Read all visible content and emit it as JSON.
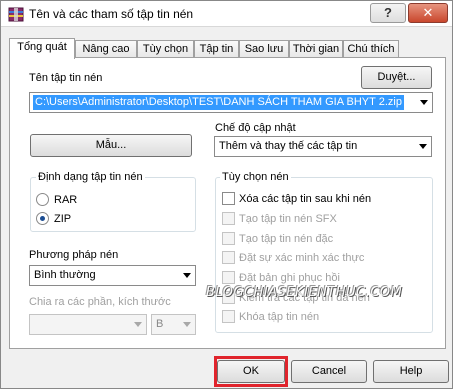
{
  "window": {
    "title": "Tên và các tham số tập tin nén",
    "help_label": "?",
    "close_label": "✕"
  },
  "tabs": [
    {
      "label": "Tổng quát"
    },
    {
      "label": "Nâng cao"
    },
    {
      "label": "Tùy chọn"
    },
    {
      "label": "Tập tin"
    },
    {
      "label": "Sao lưu"
    },
    {
      "label": "Thời gian"
    },
    {
      "label": "Chú thích"
    }
  ],
  "general": {
    "archive_name_label": "Tên tập tin nén",
    "browse_label": "Duyệt...",
    "archive_path": "C:\\Users\\Administrator\\Desktop\\TEST\\DANH SÁCH THAM GIA BHYT 2.zip",
    "update_mode_label": "Chế độ cập nhật",
    "update_mode_value": "Thêm và thay thế các tập tin",
    "profiles_label": "Mẫu...",
    "format_group_label": "Định dạng tập tin nén",
    "format_options": [
      "RAR",
      "ZIP"
    ],
    "format_selected": "ZIP",
    "method_label": "Phương pháp nén",
    "method_value": "Bình thường",
    "split_label": "Chia ra các phần, kích thước",
    "split_value": "",
    "split_unit": "B",
    "options_group_label": "Tùy chọn nén",
    "options": [
      {
        "label": "Xóa các tập tin sau khi nén",
        "enabled": true,
        "checked": false
      },
      {
        "label": "Tạo tập tin nén SFX",
        "enabled": false,
        "checked": false
      },
      {
        "label": "Tạo tập tin nén đặc",
        "enabled": false,
        "checked": false
      },
      {
        "label": "Đặt sự xác minh xác thực",
        "enabled": false,
        "checked": false
      },
      {
        "label": "Đặt bản ghi phục hồi",
        "enabled": false,
        "checked": false
      },
      {
        "label": "Kiểm tra các tập tin đã nén",
        "enabled": false,
        "checked": false
      },
      {
        "label": "Khóa tập tin nén",
        "enabled": false,
        "checked": false
      }
    ]
  },
  "buttons": {
    "ok": "OK",
    "cancel": "Cancel",
    "help": "Help"
  },
  "watermark": "BLOGCHIASEKIENTHUC.COM",
  "colors": {
    "selection": "#3399ff",
    "highlight_box": "#e0242c",
    "close_button": "#c9472d"
  }
}
